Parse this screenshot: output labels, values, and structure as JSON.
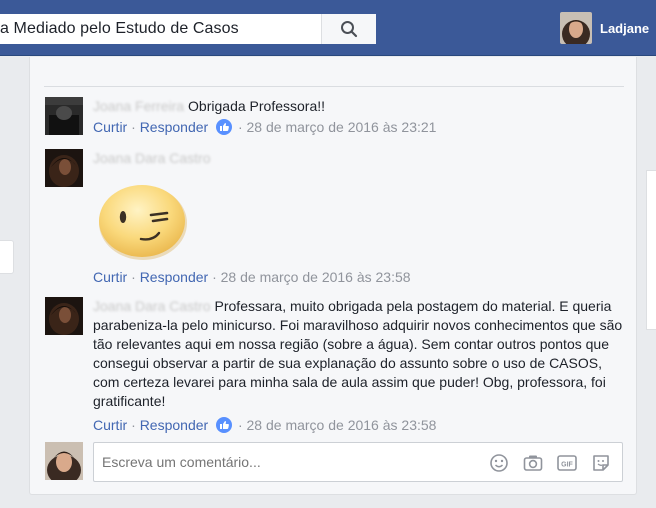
{
  "header": {
    "search_value": "a Mediado pelo Estudo de Casos",
    "user_name": "Ladjane"
  },
  "comments": [
    {
      "author": "Joana Ferreira",
      "text": "Obrigada Professora!!",
      "like_label": "Curtir",
      "reply_label": "Responder",
      "separator": "·",
      "timestamp": "· 28 de março de 2016 às 23:21"
    },
    {
      "author": "Joana Dara Castro",
      "sticker": "wink-emoji-sticker",
      "like_label": "Curtir",
      "reply_label": "Responder",
      "separator": "·",
      "timestamp": "28 de março de 2016 às 23:58"
    },
    {
      "author": "Joana Dara Castro",
      "text": "Professara, muito obrigada pela postagem do material. E queria parabeniza-la pelo minicurso. Foi maravilhoso adquirir novos conhecimentos que são tão relevantes aqui em nossa região (sobre a água). Sem contar outros pontos que consegui observar a partir de sua explanação do assunto sobre o uso de CASOS, com certeza levarei para minha sala de aula assim que puder! Obg, professora, foi gratificante!",
      "like_label": "Curtir",
      "reply_label": "Responder",
      "separator": "·",
      "timestamp": "· 28 de março de 2016 às 23:58"
    }
  ],
  "composer": {
    "placeholder": "Escreva um comentário..."
  },
  "colors": {
    "brand": "#3b5998",
    "link": "#4267b2",
    "meta": "#90949c"
  }
}
